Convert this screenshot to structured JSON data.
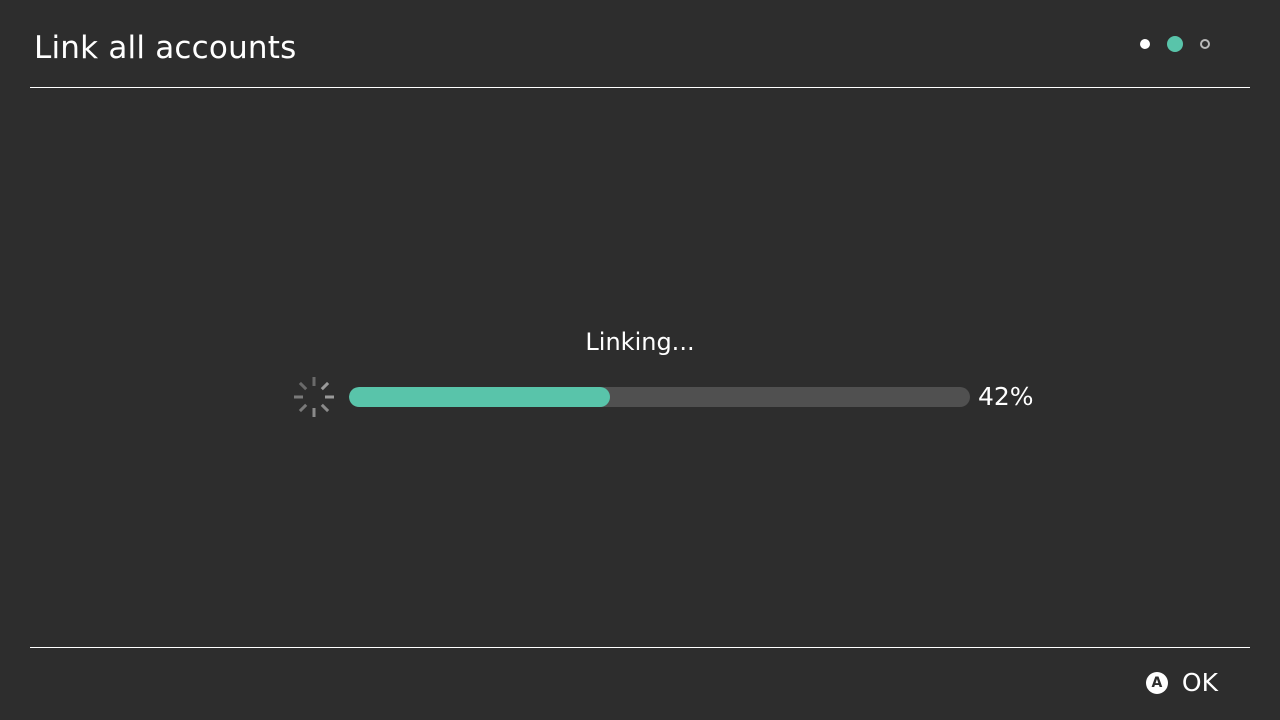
{
  "header": {
    "title": "Link all accounts"
  },
  "steps": [
    {
      "state": "done",
      "color": "#ffffff"
    },
    {
      "state": "current",
      "color": "#59c4aa"
    },
    {
      "state": "upcoming",
      "color": "#b8b8b8"
    }
  ],
  "progress": {
    "status_text": "Linking...",
    "percent_label": "42%",
    "fraction": 0.42,
    "fill_color": "#59c4aa",
    "track_color": "#505050"
  },
  "footer": {
    "button_glyph": "A",
    "action_label": "OK"
  },
  "colors": {
    "background": "#2d2d2d",
    "accent": "#59c4aa",
    "text": "#ffffff"
  }
}
